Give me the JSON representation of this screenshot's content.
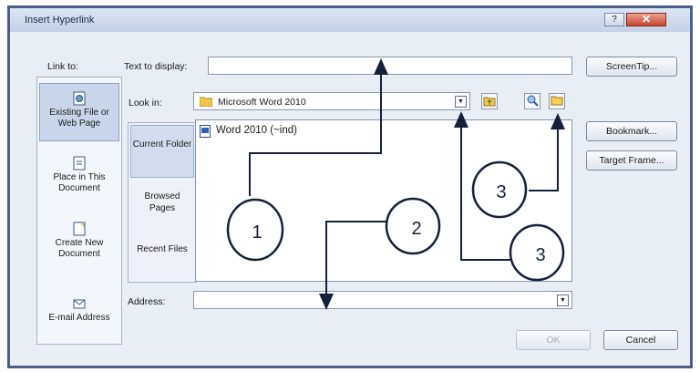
{
  "window": {
    "title": "Insert Hyperlink",
    "help_label": "?",
    "close_label": "✕"
  },
  "link_to": {
    "label": "Link to:",
    "items": [
      {
        "label": "Existing File or Web Page",
        "icon": "web-page-icon",
        "selected": true
      },
      {
        "label": "Place in This Document",
        "icon": "document-place-icon",
        "selected": false
      },
      {
        "label": "Create New Document",
        "icon": "new-document-icon",
        "selected": false
      },
      {
        "label": "E-mail Address",
        "icon": "email-icon",
        "selected": false
      }
    ]
  },
  "text_to_display": {
    "label": "Text to display:",
    "value": ""
  },
  "screentip_button": "ScreenTip...",
  "look_in": {
    "label": "Look in:",
    "value": "Microsoft Word 2010"
  },
  "browse_tabs": [
    {
      "label": "Current Folder",
      "selected": true
    },
    {
      "label": "Browsed Pages",
      "selected": false
    },
    {
      "label": "Recent Files",
      "selected": false
    }
  ],
  "files": [
    {
      "name": "Word 2010 (~ind)",
      "icon": "word-document-icon"
    }
  ],
  "side_buttons": {
    "bookmark": "Bookmark...",
    "target_frame": "Target Frame..."
  },
  "address": {
    "label": "Address:",
    "value": ""
  },
  "footer": {
    "ok": "OK",
    "cancel": "Cancel"
  },
  "callouts": [
    "1",
    "2",
    "3",
    "3"
  ]
}
